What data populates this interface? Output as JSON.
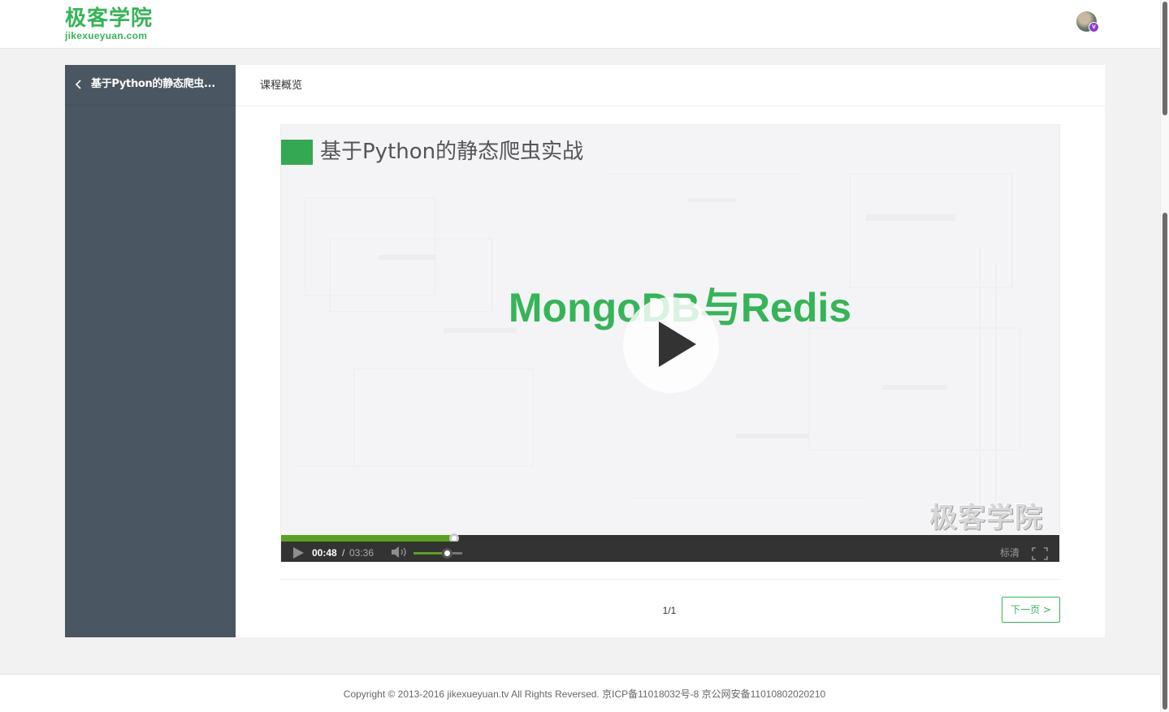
{
  "header": {
    "logo_cn": "极客学院",
    "logo_en": "jikexueyuan.com",
    "avatar_badge": "v"
  },
  "sidebar": {
    "course_title": "基于Python的静态爬虫..."
  },
  "tabs": {
    "overview": "课程概览"
  },
  "video": {
    "slide_title": "基于Python的静态爬虫实战",
    "slide_heading": "MongoDB与Redis",
    "watermark": "极客学院",
    "current_time": "00:48",
    "separator": "/",
    "total_time": "03:36",
    "progress_fraction": 0.222,
    "volume_fraction": 0.68,
    "quality": "标清",
    "icons": {
      "play_overlay": "play-icon",
      "play_control": "play-icon",
      "volume": "volume-icon",
      "fullscreen": "fullscreen-icon"
    }
  },
  "pagination": {
    "page_count": "1/1",
    "next_label": "下一页 >"
  },
  "footer": {
    "copyright": "Copyright © 2013-2016 jikexueyuan.tv All Rights Reversed. 京ICP备11018032号-8 京公网安备11010802020210"
  },
  "colors": {
    "brand_green": "#35b558",
    "sidebar_bg": "#4a5661",
    "progress_green": "#5ba11d",
    "control_bar": "#333333",
    "vip_purple": "#8a3fd1"
  }
}
